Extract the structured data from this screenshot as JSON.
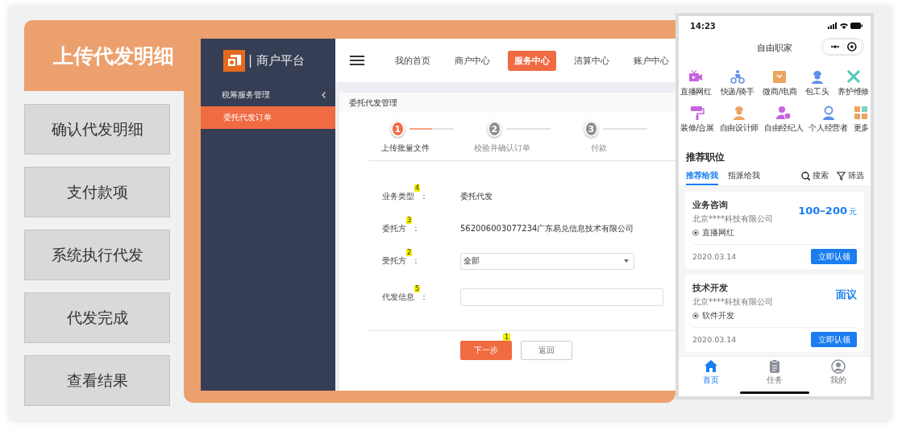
{
  "steps_panel": {
    "steps": [
      {
        "label": "上传代发明细",
        "selected": true
      },
      {
        "label": "确认代发明细",
        "selected": false
      },
      {
        "label": "支付款项",
        "selected": false
      },
      {
        "label": "系统执行代发",
        "selected": false
      },
      {
        "label": "代发完成",
        "selected": false
      },
      {
        "label": "查看结果",
        "selected": false
      }
    ]
  },
  "web": {
    "logo_text": "| 商户平台",
    "sidebar": {
      "group": {
        "label": "税筹服务管理",
        "expanded": true
      },
      "items": [
        {
          "label": "委托代发订单",
          "selected": true
        }
      ]
    },
    "nav": [
      {
        "label": "我的首页",
        "selected": false
      },
      {
        "label": "商户中心",
        "selected": false
      },
      {
        "label": "服务中心",
        "selected": true
      },
      {
        "label": "清算中心",
        "selected": false
      },
      {
        "label": "账户中心",
        "selected": false
      }
    ],
    "page_title": "委托代发管理",
    "wizard": [
      {
        "number": "1",
        "label": "上传批量文件",
        "selected": true
      },
      {
        "number": "2",
        "label": "校验并确认订单",
        "selected": false
      },
      {
        "number": "3",
        "label": "付款",
        "selected": false
      }
    ],
    "form": [
      {
        "kind": "text",
        "label": "业务类型",
        "badge": "4",
        "suffix": "：",
        "value": "委托代发"
      },
      {
        "kind": "text",
        "label": "委托方",
        "badge": "3",
        "suffix": "：",
        "value": "562006003077234广东易兑信息技术有限公司"
      },
      {
        "kind": "select",
        "label": "受托方",
        "badge": "2",
        "suffix": "：",
        "value": "全部"
      },
      {
        "kind": "input",
        "label": "代发信息",
        "badge": "5",
        "suffix": "："
      }
    ],
    "buttons": [
      {
        "kind": "primary",
        "label": "下一步",
        "badge": "1"
      },
      {
        "kind": "secondary",
        "label": "返回"
      }
    ]
  },
  "phone": {
    "time": "14:23",
    "title": "自由职家",
    "categories": [
      {
        "label": "直播网红",
        "color": "#c563e0"
      },
      {
        "label": "快递/骑手",
        "color": "#6b8fe8"
      },
      {
        "label": "微商/电商",
        "color": "#eba560"
      },
      {
        "label": "包工头",
        "color": "#5b8ee8"
      },
      {
        "label": "养护维修",
        "color": "#4fc9b4"
      },
      {
        "label": "装修/合展",
        "color": "#c563e0"
      },
      {
        "label": "自由设计师",
        "color": "#eba560"
      },
      {
        "label": "自由经纪人",
        "color": "#c563e0"
      },
      {
        "label": "个人经营者",
        "color": "#5b8ee8"
      },
      {
        "label": "更多",
        "color": "#eba560"
      }
    ],
    "section_title": "推荐职位",
    "tabs": [
      {
        "label": "推荐给我",
        "selected": true
      },
      {
        "label": "指派给我",
        "selected": false
      }
    ],
    "actions": [
      "搜索",
      "筛选"
    ],
    "jobs": [
      {
        "title": "业务咨询",
        "company": "北京****科技有限公司",
        "tag": "直播网红",
        "pay": "100–200",
        "pay_unit": "元",
        "date": "2020.03.14",
        "button": "立即认领"
      },
      {
        "title": "技术开发",
        "company": "北京****科技有限公司",
        "tag": "软件开发",
        "pay": "面议",
        "date": "2020.03.14",
        "button": "立即认领"
      }
    ],
    "tab_bar": [
      {
        "label": "首页",
        "selected": true
      },
      {
        "label": "任务",
        "selected": false
      },
      {
        "label": "我的",
        "selected": false
      }
    ]
  }
}
